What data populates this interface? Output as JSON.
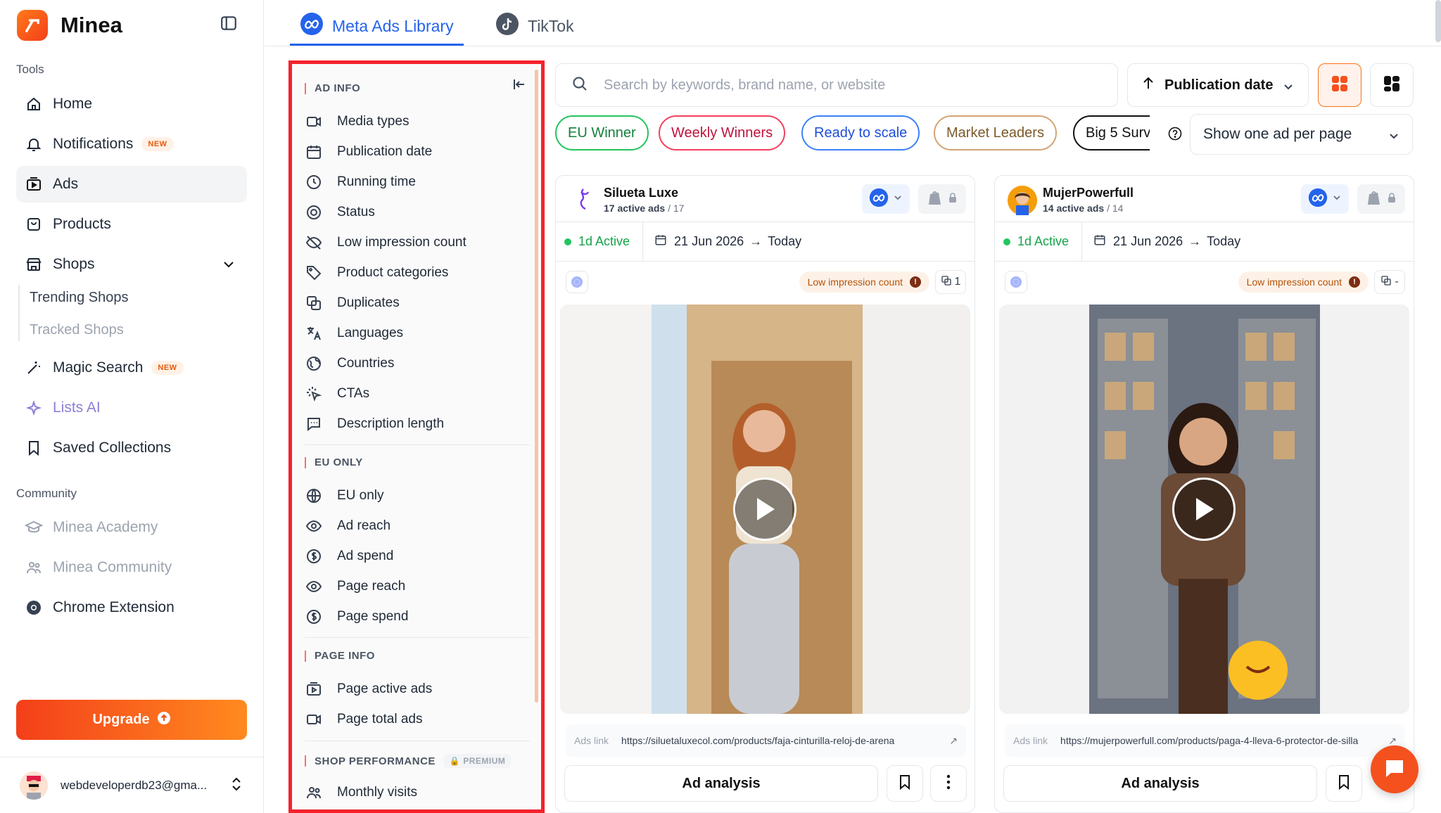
{
  "brand": {
    "name": "Minea"
  },
  "sidebar": {
    "tools_label": "Tools",
    "community_label": "Community",
    "items": {
      "home": "Home",
      "notifications": "Notifications",
      "ads": "Ads",
      "products": "Products",
      "shops": "Shops",
      "trending_shops": "Trending Shops",
      "tracked_shops": "Tracked Shops",
      "magic_search": "Magic Search",
      "lists_ai": "Lists AI",
      "saved_collections": "Saved Collections",
      "academy": "Minea Academy",
      "community": "Minea Community",
      "chrome_extension": "Chrome Extension"
    },
    "new_badge": "NEW",
    "upgrade": "Upgrade",
    "user_email": "webdeveloperdb23@gma..."
  },
  "tabs": {
    "meta": "Meta Ads Library",
    "tiktok": "TikTok"
  },
  "filters": {
    "ad_info": {
      "title": "AD INFO",
      "items": [
        "Media types",
        "Publication date",
        "Running time",
        "Status",
        "Low impression count",
        "Product categories",
        "Duplicates",
        "Languages",
        "Countries",
        "CTAs",
        "Description length"
      ]
    },
    "eu_only": {
      "title": "EU ONLY",
      "items": [
        "EU only",
        "Ad reach",
        "Ad spend",
        "Page reach",
        "Page spend"
      ]
    },
    "page_info": {
      "title": "PAGE INFO",
      "items": [
        "Page active ads",
        "Page total ads"
      ]
    },
    "shop_performance": {
      "title": "SHOP PERFORMANCE",
      "premium": "PREMIUM",
      "items": [
        "Monthly visits"
      ]
    }
  },
  "search": {
    "placeholder": "Search by keywords, brand name, or website"
  },
  "sort": {
    "label": "Publication date"
  },
  "chips": [
    "EU Winner",
    "Weekly Winners",
    "Ready to scale",
    "Market Leaders",
    "Big 5 Surv"
  ],
  "per_page": {
    "label": "Show one ad per page"
  },
  "cards": [
    {
      "brand": "Silueta Luxe",
      "active_ads": "17 active ads",
      "total": "/ 17",
      "status": "1d Active",
      "date_from": "21 Jun 2026",
      "date_to": "Today",
      "low_impression": "Low impression count",
      "dup_count": "1",
      "ads_link_label": "Ads link",
      "ads_link": "https://siluetaluxecol.com/products/faja-cinturilla-reloj-de-arena",
      "analysis": "Ad analysis"
    },
    {
      "brand": "MujerPowerfull",
      "active_ads": "14 active ads",
      "total": "/ 14",
      "status": "1d Active",
      "date_from": "21 Jun 2026",
      "date_to": "Today",
      "low_impression": "Low impression count",
      "dup_count": "-",
      "ads_link_label": "Ads link",
      "ads_link": "https://mujerpowerfull.com/products/paga-4-lleva-6-protector-de-silla",
      "analysis": "Ad analysis"
    }
  ],
  "colors": {
    "accent": "#f4511e",
    "meta_blue": "#2563eb",
    "active_green": "#16a34a",
    "panel_outline": "#f5222d"
  }
}
